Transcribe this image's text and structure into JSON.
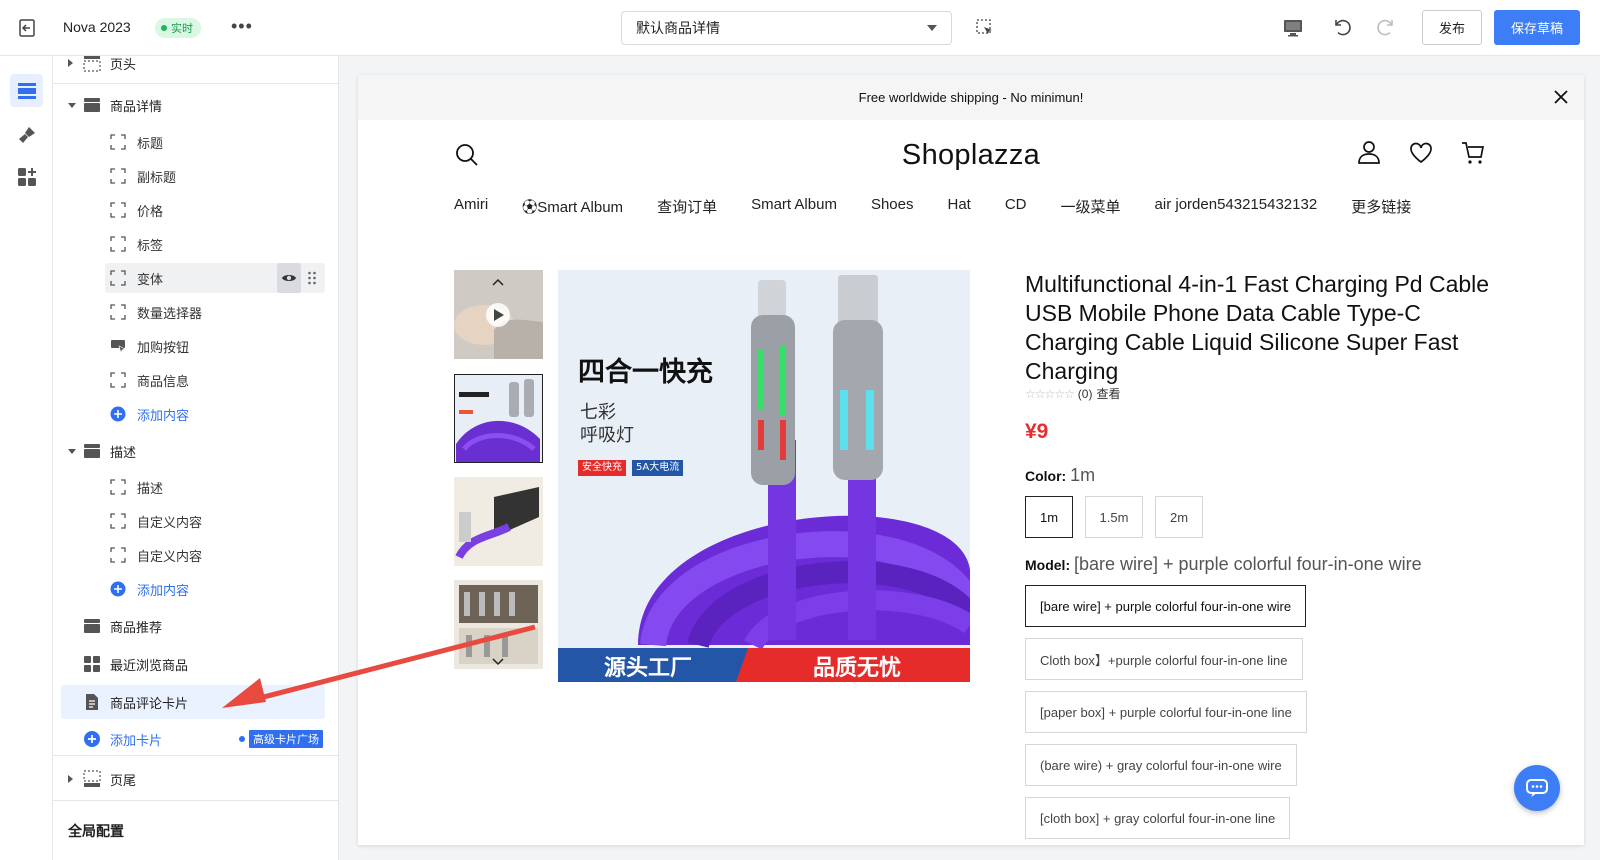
{
  "topbar": {
    "store_name": "Nova 2023",
    "live_label": "实时",
    "more_label": "•••",
    "page_select_value": "默认商品详情",
    "publish_label": "发布",
    "save_label": "保存草稿"
  },
  "sidebar": {
    "header_label": "页头",
    "product_detail": {
      "label": "商品详情",
      "children": [
        {
          "label": "标题"
        },
        {
          "label": "副标题"
        },
        {
          "label": "价格"
        },
        {
          "label": "标签"
        },
        {
          "label": "变体"
        },
        {
          "label": "数量选择器"
        },
        {
          "label": "加购按钮"
        },
        {
          "label": "商品信息"
        }
      ],
      "add_label": "添加内容"
    },
    "description": {
      "label": "描述",
      "children": [
        {
          "label": "描述"
        },
        {
          "label": "自定义内容"
        },
        {
          "label": "自定义内容"
        }
      ],
      "add_label": "添加内容"
    },
    "recommend_label": "商品推荐",
    "recent_label": "最近浏览商品",
    "review_card_label": "商品评论卡片",
    "add_card_label": "添加卡片",
    "advanced_badge": "高级卡片广场",
    "footer_label": "页尾",
    "global_config_label": "全局配置"
  },
  "canvas": {
    "announcement": "Free worldwide shipping - No minimun!",
    "store_logo": "Shoplazza",
    "nav": [
      "Amiri",
      "Smart Album",
      "查询订单",
      "Smart Album",
      "Shoes",
      "Hat",
      "CD",
      "一级菜单",
      "air jorden543215432132",
      "更多链接"
    ],
    "product": {
      "title": "Multifunctional 4-in-1 Fast Charging Pd Cable USB Mobile Phone Data Cable Type-C Charging Cable Liquid Silicone Super Fast Charging",
      "rating_count": "(0)",
      "rating_link": "查看",
      "price": "¥9",
      "color_label": "Color:",
      "color_value": "1m",
      "colors": [
        "1m",
        "1.5m",
        "2m"
      ],
      "model_label": "Model:",
      "model_value": "[bare wire] + purple colorful four-in-one wire",
      "models": [
        "[bare wire] + purple colorful four-in-one wire",
        "Cloth box】+purple colorful four-in-one line",
        "[paper box] + purple colorful four-in-one line",
        "(bare wire) + gray colorful four-in-one wire",
        "[cloth box] + gray colorful four-in-one line"
      ]
    },
    "image_text": {
      "headline": "四合一快充",
      "sub1": "七彩",
      "sub2": "呼吸灯",
      "tag_red": "安全快充",
      "tag_blue": "5A大电流",
      "footer_left": "源头工厂",
      "footer_right": "品质无忧"
    }
  },
  "colors": {
    "accent": "#3d7df5",
    "price": "#e52d2d",
    "live_bg": "#d9f7e3",
    "annotation_arrow": "#e84a3f"
  }
}
